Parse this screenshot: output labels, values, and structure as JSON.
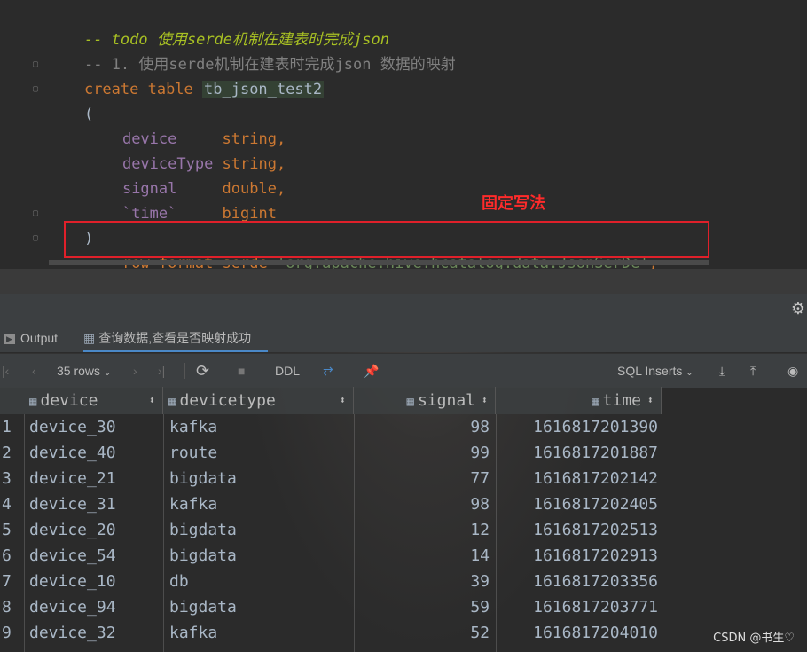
{
  "code": {
    "line1_prefix": "-- ",
    "line1_todo": "todo 使用serde机制在建表时完成json",
    "line2": "-- 1. 使用serde机制在建表时完成json 数据的映射",
    "create_kw": "create table ",
    "table_name": "tb_json_test2",
    "open_paren": "(",
    "fields": [
      {
        "name": "device    ",
        "type": " string,"
      },
      {
        "name": "deviceType",
        "type": " string,"
      },
      {
        "name": "signal    ",
        "type": " double,"
      },
      {
        "name": "`time`    ",
        "type": " bigint"
      }
    ],
    "close_paren": ")",
    "serde_kw": "row format serde ",
    "serde_str": "'org.apache.hive.hcatalog.data.JsonSerDe'",
    "serde_end": ";"
  },
  "annotation": "固定写法",
  "tabs": {
    "output": "Output",
    "result": "查询数据,查看是否映射成功"
  },
  "toolbar": {
    "rows": "35 rows",
    "ddl": "DDL",
    "export_format": "SQL Inserts"
  },
  "table": {
    "headers": [
      "device",
      "devicetype",
      "signal",
      "time"
    ],
    "rows": [
      {
        "n": "1",
        "device": "device_30",
        "devicetype": "kafka",
        "signal": "98",
        "time": "1616817201390"
      },
      {
        "n": "2",
        "device": "device_40",
        "devicetype": "route",
        "signal": "99",
        "time": "1616817201887"
      },
      {
        "n": "3",
        "device": "device_21",
        "devicetype": "bigdata",
        "signal": "77",
        "time": "1616817202142"
      },
      {
        "n": "4",
        "device": "device_31",
        "devicetype": "kafka",
        "signal": "98",
        "time": "1616817202405"
      },
      {
        "n": "5",
        "device": "device_20",
        "devicetype": "bigdata",
        "signal": "12",
        "time": "1616817202513"
      },
      {
        "n": "6",
        "device": "device_54",
        "devicetype": "bigdata",
        "signal": "14",
        "time": "1616817202913"
      },
      {
        "n": "7",
        "device": "device_10",
        "devicetype": "db",
        "signal": "39",
        "time": "1616817203356"
      },
      {
        "n": "8",
        "device": "device_94",
        "devicetype": "bigdata",
        "signal": "59",
        "time": "1616817203771"
      },
      {
        "n": "9",
        "device": "device_32",
        "devicetype": "kafka",
        "signal": "52",
        "time": "1616817204010"
      }
    ]
  },
  "watermark": "CSDN @书生♡"
}
